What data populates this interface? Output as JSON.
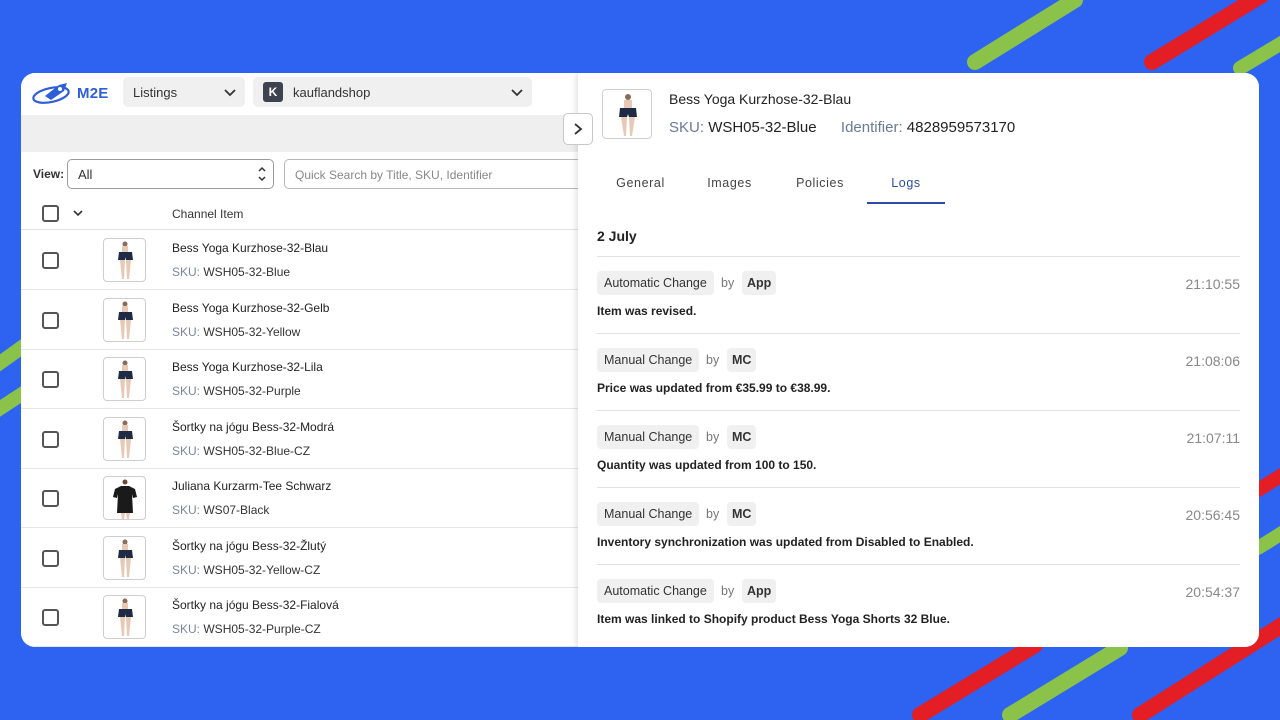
{
  "colors": {
    "background": "#2e62f0",
    "accent": "#2c4ba8",
    "stripe_green": "#8bc34a",
    "stripe_red": "#e31e24"
  },
  "header": {
    "logo_text": "M2E",
    "listings_select": "Listings",
    "shop_badge": "K",
    "shop_select": "kauflandshop"
  },
  "filters": {
    "view_label": "View:",
    "view_value": "All",
    "search_placeholder": "Quick Search by Title, SKU, Identifier"
  },
  "table": {
    "column_header": "Channel Item",
    "sku_prefix": "SKU:",
    "rows": [
      {
        "title": "Bess Yoga Kurzhose-32-Blau",
        "sku": "WSH05-32-Blue",
        "product": "shorts"
      },
      {
        "title": "Bess Yoga Kurzhose-32-Gelb",
        "sku": "WSH05-32-Yellow",
        "product": "shorts"
      },
      {
        "title": "Bess Yoga Kurzhose-32-Lila",
        "sku": "WSH05-32-Purple",
        "product": "shorts"
      },
      {
        "title": "Šortky na jógu Bess-32-Modrá",
        "sku": "WSH05-32-Blue-CZ",
        "product": "shorts"
      },
      {
        "title": "Juliana Kurzarm-Tee Schwarz",
        "sku": "WS07-Black",
        "product": "tee"
      },
      {
        "title": "Šortky na jógu Bess-32-Žlutý",
        "sku": "WSH05-32-Yellow-CZ",
        "product": "shorts"
      },
      {
        "title": "Šortky na jógu Bess-32-Fialová",
        "sku": "WSH05-32-Purple-CZ",
        "product": "shorts"
      }
    ]
  },
  "detail": {
    "title": "Bess Yoga Kurzhose-32-Blau",
    "sku_label": "SKU:",
    "sku": "WSH05-32-Blue",
    "identifier_label": "Identifier:",
    "identifier": "4828959573170",
    "tabs": [
      {
        "label": "General",
        "active": false
      },
      {
        "label": "Images",
        "active": false
      },
      {
        "label": "Policies",
        "active": false
      },
      {
        "label": "Logs",
        "active": true
      }
    ],
    "log_date": "2 July",
    "by_label": "by",
    "logs": [
      {
        "type": "Automatic Change",
        "author": "App",
        "time": "21:10:55",
        "message": "Item was revised."
      },
      {
        "type": "Manual Change",
        "author": "MC",
        "time": "21:08:06",
        "message": "Price was updated from €35.99 to €38.99."
      },
      {
        "type": "Manual Change",
        "author": "MC",
        "time": "21:07:11",
        "message": "Quantity was updated from 100 to 150."
      },
      {
        "type": "Manual Change",
        "author": "MC",
        "time": "20:56:45",
        "message": "Inventory synchronization was updated from Disabled to Enabled."
      },
      {
        "type": "Automatic Change",
        "author": "App",
        "time": "20:54:37",
        "message": "Item was linked to Shopify product Bess Yoga Shorts 32 Blue."
      }
    ]
  }
}
